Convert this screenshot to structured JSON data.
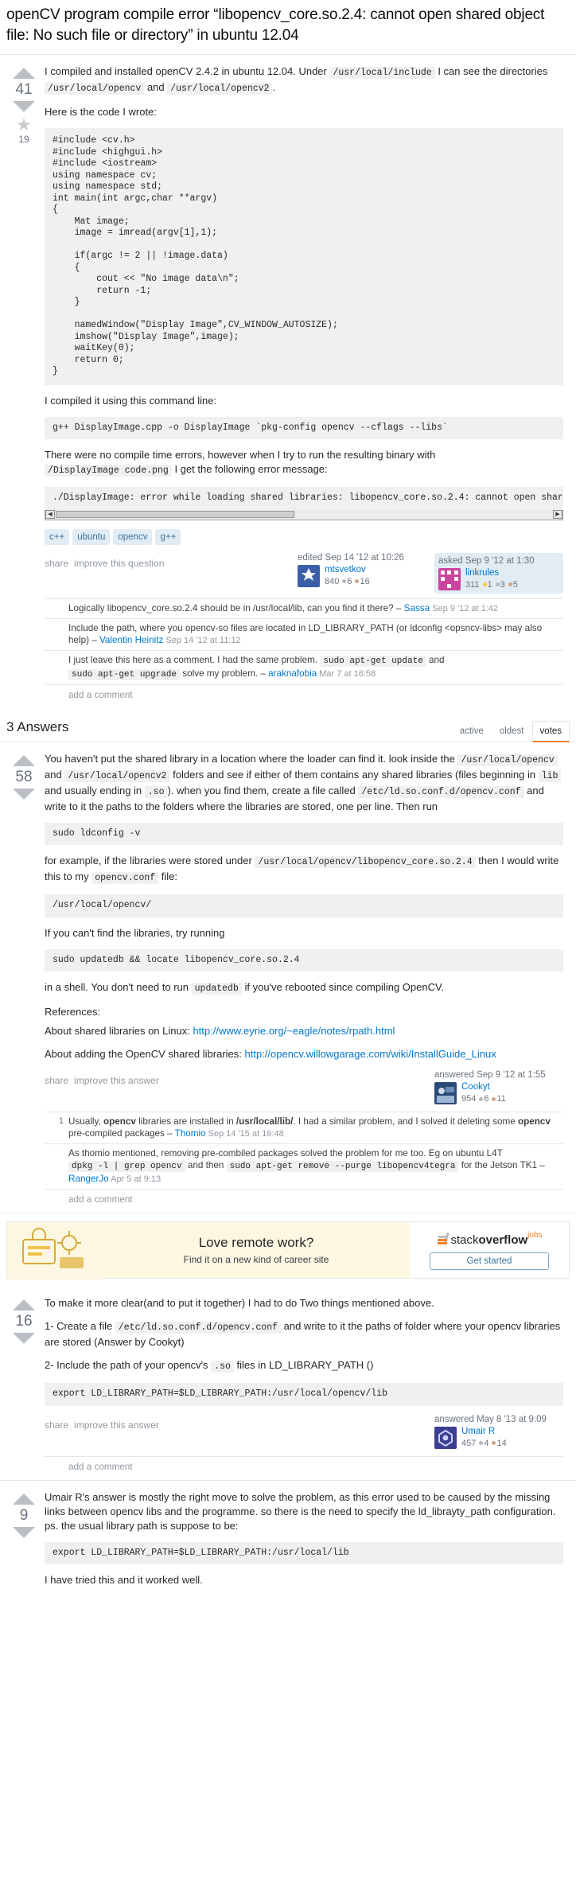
{
  "question": {
    "title": "openCV program compile error “libopencv_core.so.2.4: cannot open shared object file: No such file or directory” in ubuntu 12.04",
    "votes": "41",
    "favorites": "19",
    "star_glyph": "★",
    "body": {
      "p1_a": "I compiled and installed openCV 2.4.2 in ubuntu 12.04. Under ",
      "p1_code1": "/usr/local/include",
      "p1_b": " I can see the directories ",
      "p1_code2": "/usr/local/opencv",
      "p1_c": " and ",
      "p1_code3": "/usr/local/opencv2",
      "p1_d": ".",
      "p2": "Here is the code I wrote:",
      "code": "#include <cv.h>\n#include <highgui.h>\n#include <iostream>\nusing namespace cv;\nusing namespace std;\nint main(int argc,char **argv)\n{\n    Mat image;\n    image = imread(argv[1],1);\n\n    if(argc != 2 || !image.data)\n    {\n        cout << \"No image data\\n\";\n        return -1;\n    }\n\n    namedWindow(\"Display Image\",CV_WINDOW_AUTOSIZE);\n    imshow(\"Display Image\",image);\n    waitKey(0);\n    return 0;\n}",
      "p3": "I compiled it using this command line:",
      "cmd": "g++ DisplayImage.cpp -o DisplayImage `pkg-config opencv --cflags --libs`",
      "p4_a": "There were no compile time errors, however when I try to run the resulting binary with ",
      "p4_code": "/DisplayImage code.png",
      "p4_b": " I get the following error message:",
      "error": "./DisplayImage: error while loading shared libraries: libopencv_core.so.2.4: cannot open share"
    },
    "tags": [
      "c++",
      "ubuntu",
      "opencv",
      "g++"
    ],
    "menu": {
      "share": "share",
      "improve": "improve this question"
    },
    "editor": {
      "action": "edited",
      "date": "Sep 14 '12 at 10:26",
      "name": "mtsvetkov",
      "rep": "840",
      "gold": "6",
      "silver": "16"
    },
    "asker": {
      "action": "asked",
      "date": "Sep 9 '12 at 1:30",
      "name": "linkrules",
      "rep": "311",
      "gold": "1",
      "silver": "3",
      "bronze": "5"
    },
    "comments": [
      {
        "score": "",
        "text": "Logically libopencv_core.so.2.4 should be in /usr/local/lib, can you find it there? – ",
        "user": "Sassa",
        "date": " Sep 9 '12 at 1:42",
        "code": ""
      },
      {
        "score": "",
        "text": "Include the path, where you opencv-so files are located in LD_LIBRARY_PATH  (or ldconfig <opsncv-libs> may also help) – ",
        "user": "Valentin Heinitz",
        "date": " Sep 14 '12 at 11:12",
        "code": ""
      },
      {
        "score": "",
        "text": "I just leave this here as a comment. I had the same problem. ",
        "code1": "sudo apt-get update",
        "mid1": " and ",
        "code2": "sudo apt-get upgrade",
        "mid2": " solve my problem. – ",
        "user": "araknafobia",
        "date": " Mar 7 at 16:58"
      }
    ],
    "add_comment": "add a comment"
  },
  "answers_section": {
    "count_label": "3 Answers",
    "tabs": [
      {
        "label": "active",
        "active": false
      },
      {
        "label": "oldest",
        "active": false
      },
      {
        "label": "votes",
        "active": true
      }
    ]
  },
  "answers": [
    {
      "votes": "58",
      "body": {
        "p1_a": "You haven't put the shared library in a location where the loader can find it. look inside the ",
        "p1_c1": "/usr/local/opencv",
        "p1_b": " and ",
        "p1_c2": "/usr/local/opencv2",
        "p1_c": " folders and see if either of them contains any shared libraries (files beginning in ",
        "p1_c3": "lib",
        "p1_d": " and usually ending in ",
        "p1_c4": ".so",
        "p1_e": "). when you find them, create a file called ",
        "p1_c5": "/etc/ld.so.conf.d/opencv.conf",
        "p1_f": " and write to it the paths to the folders where the libraries are stored, one per line. Then run",
        "cmd1": "sudo ldconfig -v",
        "p2_a": "for example, if the libraries were stored under ",
        "p2_c1": "/usr/local/opencv/libopencv_core.so.2.4",
        "p2_b": " then I would write this to my ",
        "p2_c2": "opencv.conf",
        "p2_c": " file:",
        "cmd2": "/usr/local/opencv/",
        "p3": "If you can't find the libraries, try running",
        "cmd3": "sudo updatedb && locate libopencv_core.so.2.4",
        "p4_a": "in a shell. You don't need to run ",
        "p4_c1": "updatedb",
        "p4_b": " if you've rebooted since compiling OpenCV.",
        "refs_label": "References:",
        "ref1_text": "About shared libraries on Linux: ",
        "ref1_link": "http://www.eyrie.org/~eagle/notes/rpath.html",
        "ref2_text": "About adding the OpenCV shared libraries: ",
        "ref2_link": "http://opencv.willowgarage.com/wiki/InstallGuide_Linux"
      },
      "menu": {
        "share": "share",
        "improve": "improve this answer"
      },
      "author": {
        "action": "answered",
        "date": "Sep 9 '12 at 1:55",
        "name": "Cookyt",
        "rep": "954",
        "gold": "6",
        "silver": "11"
      },
      "comments": [
        {
          "score": "1",
          "text_a": "Usually, ",
          "bold1": "opencv",
          "text_b": " libraries are installed in ",
          "bold2": "/usr/local/lib/",
          "text_c": ". I had a similar problem, and I solved it deleting some ",
          "bold3": "opencv",
          "text_d": " pre-compiled packages – ",
          "user": "Thomio",
          "date": " Sep 14 '15 at 16:48"
        },
        {
          "score": "",
          "text_a": "As thomio mentioned, removing pre-combiled packages solved the problem for me too. Eg on ubuntu L4T ",
          "code1": "dpkg -l | grep opencv",
          "mid1": " and then ",
          "code2": "sudo apt-get remove --purge libopencv4tegra",
          "mid2": " for the Jetson TK1 – ",
          "user": "RangerJo",
          "date": " Apr 5 at 9:13"
        }
      ],
      "add_comment": "add a comment"
    },
    {
      "votes": "16",
      "body": {
        "p1": "To make it more clear(and to put it together) I had to do Two things mentioned above.",
        "p2_a": "1- Create a file ",
        "p2_c1": "/etc/ld.so.conf.d/opencv.conf",
        "p2_b": " and write to it the paths of folder where your opencv libraries are stored (Answer by Cookyt)",
        "p3_a": "2- Include the path of your opencv's ",
        "p3_c1": ".so",
        "p3_b": " files in LD_LIBRARY_PATH ()",
        "cmd1": "export LD_LIBRARY_PATH=$LD_LIBRARY_PATH:/usr/local/opencv/lib"
      },
      "menu": {
        "share": "share",
        "improve": "improve this answer"
      },
      "author": {
        "action": "answered",
        "date": "May 8 '13 at 9:09",
        "name": "Umair R",
        "rep": "457",
        "gold": "4",
        "silver": "14"
      },
      "comments": [],
      "add_comment": "add a comment"
    },
    {
      "votes": "9",
      "body": {
        "p1": "Umair R's answer is mostly the right move to solve the problem, as this error used to be caused by the missing links between opencv libs and the programme. so there is the need to specify the ld_librayty_path configuration. ps. the usual library path is suppose to be:",
        "cmd1": "export LD_LIBRARY_PATH=$LD_LIBRARY_PATH:/usr/local/lib",
        "p2": "I have tried this and it worked well."
      },
      "menu": {},
      "author": {},
      "comments": [],
      "add_comment": ""
    }
  ],
  "ad": {
    "title": "Love remote work?",
    "subtitle": "Find it on a new kind of career site",
    "logo_light": "stack",
    "logo_bold": "overflow",
    "logo_jobs": "jobs",
    "button": "Get started"
  },
  "colors": {
    "accent": "#f48024",
    "link": "#0077cc",
    "tag_bg": "#e1ecf4",
    "tag_fg": "#39739d",
    "code_bg": "#eff0f1",
    "arrow": "#babfc4"
  }
}
